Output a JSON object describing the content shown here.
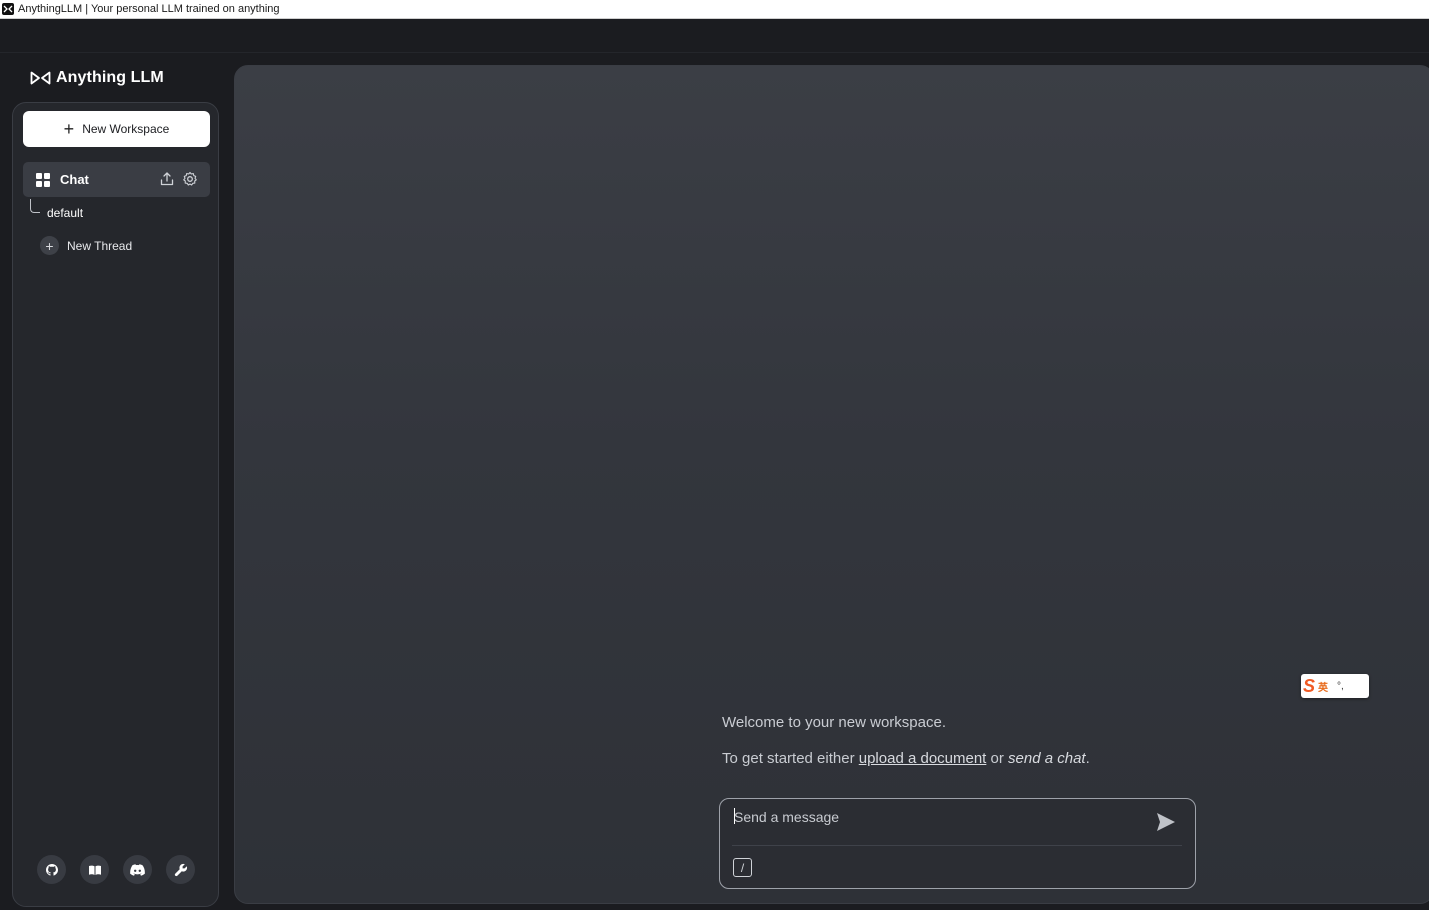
{
  "window": {
    "title": "AnythingLLM | Your personal LLM trained on anything"
  },
  "brand": {
    "name": "Anything LLM"
  },
  "sidebar": {
    "new_workspace_label": "New Workspace",
    "workspace": {
      "label": "Chat",
      "icon": "grid-icon",
      "actions": [
        "upload-icon",
        "gear-icon"
      ]
    },
    "threads": [
      {
        "label": "default"
      }
    ],
    "new_thread_label": "New Thread",
    "footer_icons": [
      "github-icon",
      "docs-book-icon",
      "discord-icon",
      "settings-wrench-icon"
    ]
  },
  "main": {
    "welcome": "Welcome to your new workspace.",
    "get_started_prefix": "To get started either",
    "upload_link": "upload a document",
    "or_text": "or",
    "send_chat_text": "send a chat",
    "period": "."
  },
  "composer": {
    "placeholder": "Send a message",
    "value": "",
    "slash_label": "/"
  },
  "ime": {
    "logo": "S",
    "lang": "英",
    "punct": "°,"
  },
  "colors": {
    "background": "#1b1c20",
    "sidebar": "#25272c",
    "accent_white": "#ffffff",
    "active_item": "#3a3d44",
    "main_panel": "#35383f"
  }
}
